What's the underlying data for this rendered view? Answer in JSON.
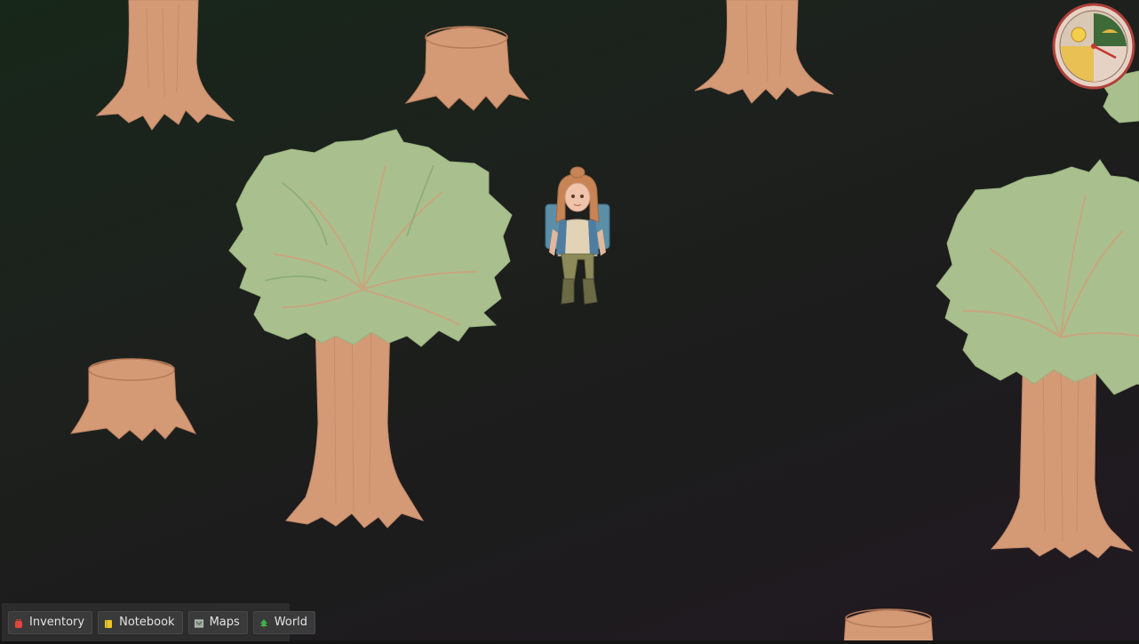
{
  "toolbar": {
    "buttons": [
      {
        "label": "Inventory",
        "icon": "backpack-icon",
        "color": "#e0463c"
      },
      {
        "label": "Notebook",
        "icon": "notebook-icon",
        "color": "#e8c62c"
      },
      {
        "label": "Maps",
        "icon": "map-icon",
        "color": "#9aa59a"
      },
      {
        "label": "World",
        "icon": "tree-icon",
        "color": "#3db24a"
      }
    ]
  },
  "colors": {
    "trunk": "#d49a76",
    "trunk_line": "#b77b58",
    "foliage": "#a9c08e",
    "foliage_dark": "#87a774",
    "background": "#1c1c1c"
  },
  "hud": {
    "clock_icon": "day-night-clock-icon"
  }
}
